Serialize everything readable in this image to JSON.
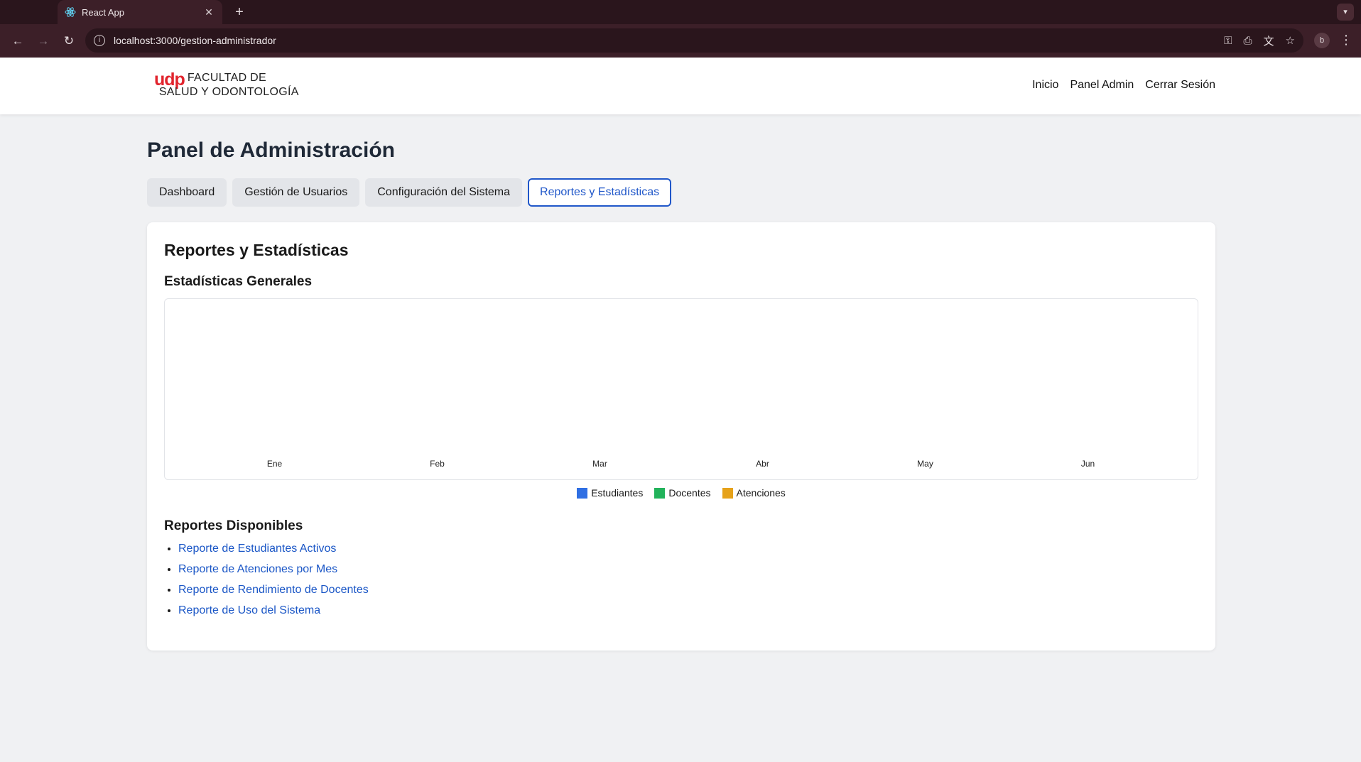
{
  "browser": {
    "tab_title": "React App",
    "url": "localhost:3000/gestion-administrador",
    "profile_initial": "b"
  },
  "header": {
    "logo_brand": "udp",
    "logo_line1": "FACULTAD DE",
    "logo_line2": "SALUD Y ODONTOLOGÍA",
    "nav": [
      "Inicio",
      "Panel Admin",
      "Cerrar Sesión"
    ]
  },
  "page": {
    "title": "Panel de Administración",
    "tabs": [
      "Dashboard",
      "Gestión de Usuarios",
      "Configuración del Sistema",
      "Reportes y Estadísticas"
    ],
    "active_tab": "Reportes y Estadísticas"
  },
  "card": {
    "title": "Reportes y Estadísticas",
    "stats_title": "Estadísticas Generales",
    "reports_title": "Reportes Disponibles",
    "reports": [
      "Reporte de Estudiantes Activos",
      "Reporte de Atenciones por Mes",
      "Reporte de Rendimiento de Docentes",
      "Reporte de Uso del Sistema"
    ]
  },
  "chart_data": {
    "type": "bar",
    "categories": [
      "Ene",
      "Feb",
      "Mar",
      "Abr",
      "May",
      "Jun"
    ],
    "series": [
      {
        "name": "Estudiantes",
        "color": "#2f6fe3",
        "values": [
          0,
          0,
          0,
          0,
          0,
          0
        ]
      },
      {
        "name": "Docentes",
        "color": "#22b35b",
        "values": [
          0,
          0,
          0,
          0,
          0,
          0
        ]
      },
      {
        "name": "Atenciones",
        "color": "#e6a21a",
        "values": [
          0,
          0,
          0,
          0,
          0,
          0
        ]
      }
    ],
    "grid": false,
    "legend_position": "bottom"
  }
}
